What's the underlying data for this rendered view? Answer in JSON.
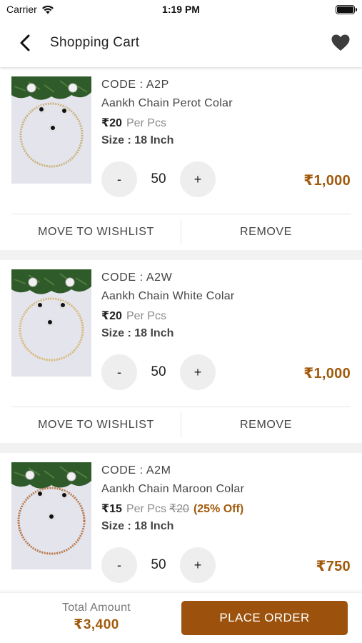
{
  "status_bar": {
    "carrier": "Carrier",
    "time": "1:19 PM"
  },
  "header": {
    "title": "Shopping Cart"
  },
  "items": [
    {
      "code": "CODE : A2P",
      "name": "Aankh Chain Perot Colar",
      "price": "₹20",
      "unit": "Per Pcs",
      "original_price": "",
      "discount": "",
      "size": "Size : 18 Inch",
      "minus": "-",
      "quantity": "50",
      "plus": "+",
      "total": "₹1,000",
      "chain_color": "#c9b27a",
      "move_label": "MOVE TO WISHLIST",
      "remove_label": "REMOVE"
    },
    {
      "code": "CODE : A2W",
      "name": "Aankh Chain White Colar",
      "price": "₹20",
      "unit": "Per Pcs",
      "original_price": "",
      "discount": "",
      "size": "Size : 18 Inch",
      "minus": "-",
      "quantity": "50",
      "plus": "+",
      "total": "₹1,000",
      "chain_color": "#d8b875",
      "move_label": "MOVE TO WISHLIST",
      "remove_label": "REMOVE"
    },
    {
      "code": "CODE : A2M",
      "name": "Aankh Chain Maroon Colar",
      "price": "₹15",
      "unit": "Per Pcs",
      "original_price": "₹20",
      "discount": "(25% Off)",
      "size": "Size : 18 Inch",
      "minus": "-",
      "quantity": "50",
      "plus": "+",
      "total": "₹750",
      "chain_color": "#b8784a",
      "move_label": "",
      "remove_label": ""
    }
  ],
  "footer": {
    "total_label": "Total Amount",
    "total_amount": "₹3,400",
    "order_label": "PLACE ORDER"
  },
  "colors": {
    "accent": "#9c520d",
    "price_brown": "#a15a0c"
  }
}
